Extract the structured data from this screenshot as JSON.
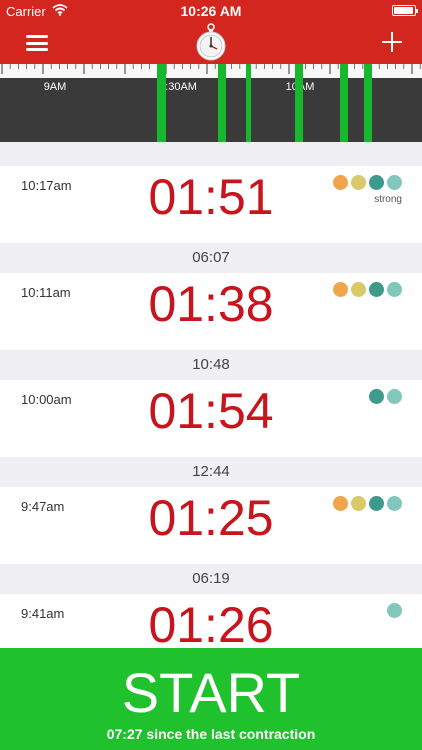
{
  "status_bar": {
    "carrier": "Carrier",
    "time": "10:26 AM",
    "battery_fraction": 0.95
  },
  "nav": {
    "menu_icon": "hamburger-menu-icon",
    "center_icon": "stopwatch-icon",
    "add_icon": "plus-icon"
  },
  "timeline": {
    "labels": [
      "9AM",
      "9:30AM",
      "10AM"
    ],
    "contraction_times": [
      "9:41am",
      "9:47am",
      "10:00am",
      "10:11am",
      "10:17am"
    ]
  },
  "colors": {
    "header": "#d3261f",
    "duration": "#c8141c",
    "start": "#1fc12d",
    "timeline_bar": "#17b82e",
    "dot_orange": "#f0a54d",
    "dot_yellow": "#d8c96b",
    "dot_teal": "#3e9a8b",
    "dot_light_teal": "#82c7bb"
  },
  "contractions": [
    {
      "time": "10:17am",
      "duration": "01:51",
      "dots": [
        "#f0a54d",
        "#d8c96b",
        "#3e9a8b",
        "#82c7bb"
      ],
      "intensity": "strong",
      "interval_after": "06:07"
    },
    {
      "time": "10:11am",
      "duration": "01:38",
      "dots": [
        "#f0a54d",
        "#d8c96b",
        "#3e9a8b",
        "#82c7bb"
      ],
      "intensity": "",
      "interval_after": "10:48"
    },
    {
      "time": "10:00am",
      "duration": "01:54",
      "dots": [
        "#3e9a8b",
        "#82c7bb"
      ],
      "intensity": "",
      "interval_after": "12:44"
    },
    {
      "time": "9:47am",
      "duration": "01:25",
      "dots": [
        "#f0a54d",
        "#d8c96b",
        "#3e9a8b",
        "#82c7bb"
      ],
      "intensity": "",
      "interval_after": "06:19"
    },
    {
      "time": "9:41am",
      "duration": "01:26",
      "dots": [
        "#82c7bb"
      ],
      "intensity": "",
      "interval_after": ""
    }
  ],
  "start": {
    "label": "START",
    "since": "07:27 since the last contraction"
  }
}
